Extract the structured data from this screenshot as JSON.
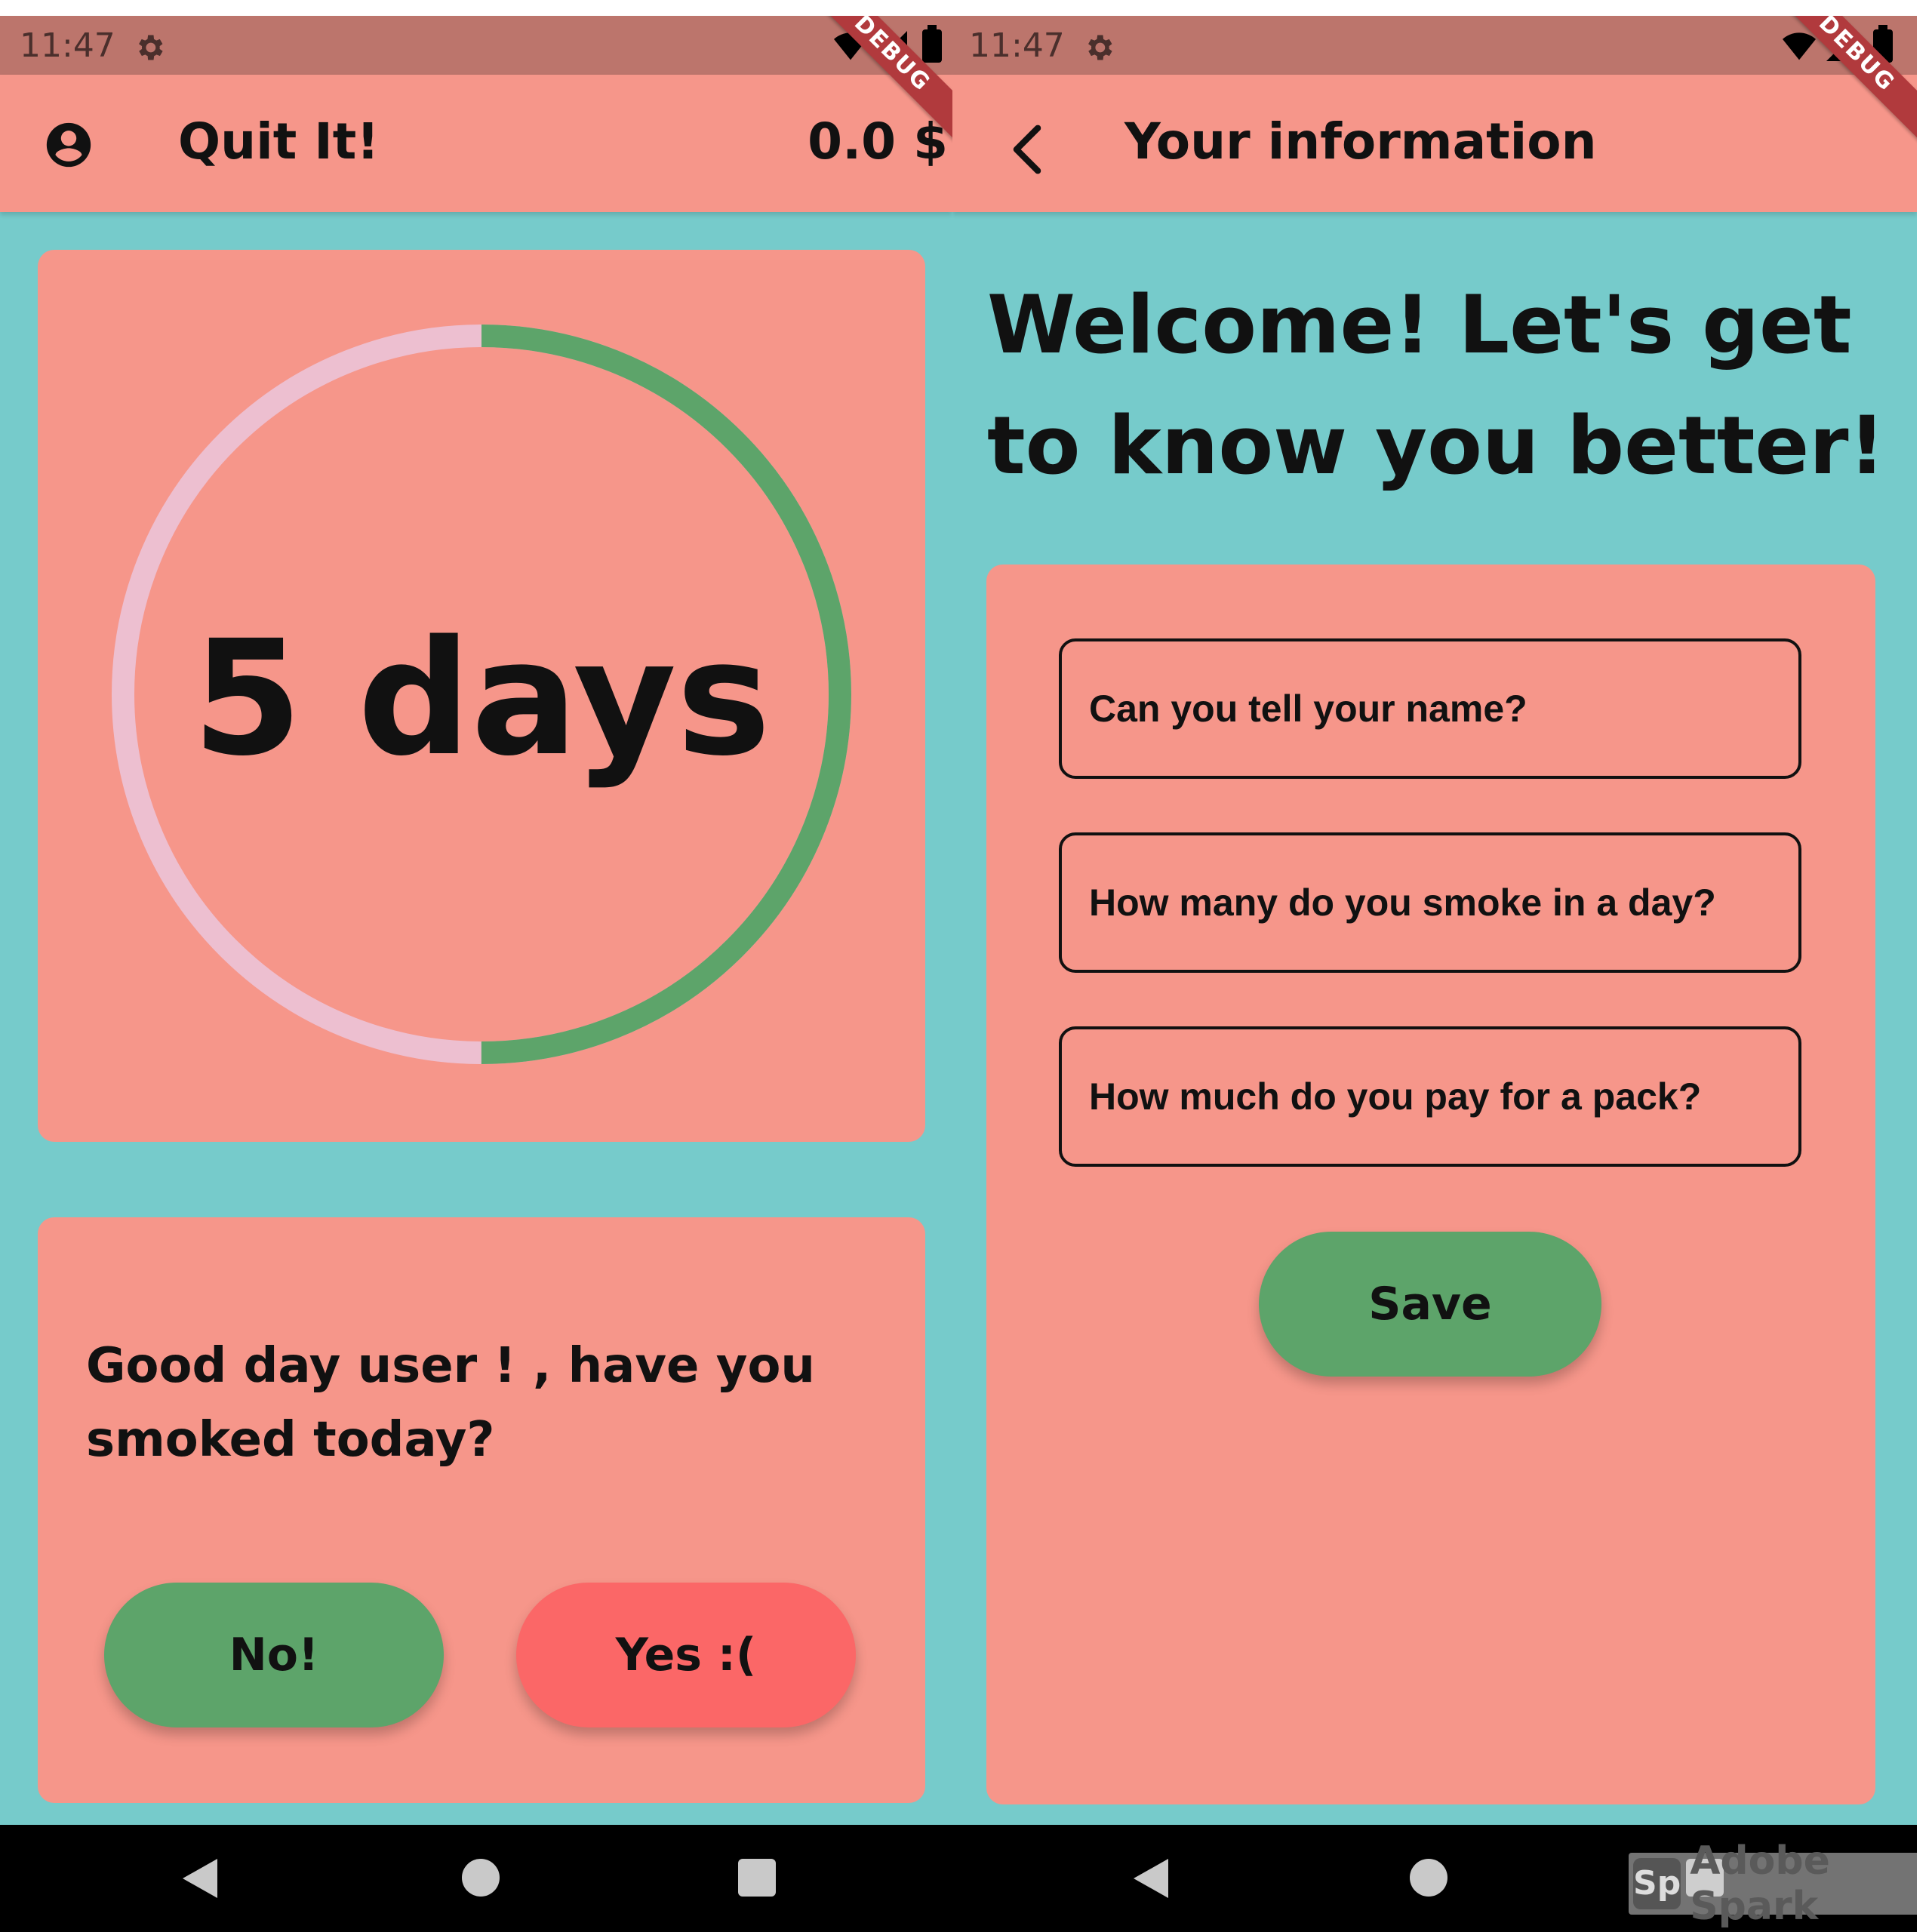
{
  "status": {
    "time": "11:47",
    "debug_label": "DEBUG"
  },
  "home": {
    "app_title": "Quit It!",
    "savings": "0.0 $",
    "days_label": "5 days",
    "days_progress_fraction": 0.5,
    "prompt": "Good day user ! , have you smoked today?",
    "no_button": "No!",
    "yes_button": "Yes :("
  },
  "info": {
    "title": "Your information",
    "welcome": "Welcome! Let's get to know you better!",
    "name_placeholder": "Can you tell your name?",
    "smoke_placeholder": "How many do you smoke in a day?",
    "price_placeholder": "How much do you pay for a pack?",
    "save_button": "Save"
  },
  "watermark": {
    "badge": "Sp",
    "text": "Adobe Spark"
  },
  "colors": {
    "background": "#76CBCB",
    "card": "#F6968A",
    "status_bar": "#BC756C",
    "green": "#5DA46A",
    "red_button": "#FB6767",
    "ring_track": "#EDBFD0"
  },
  "icons": [
    "account-circle-icon",
    "back-arrow-icon",
    "settings-icon",
    "wifi-icon",
    "signal-icon",
    "battery-icon",
    "nav-back-icon",
    "nav-home-icon",
    "nav-recent-icon"
  ]
}
